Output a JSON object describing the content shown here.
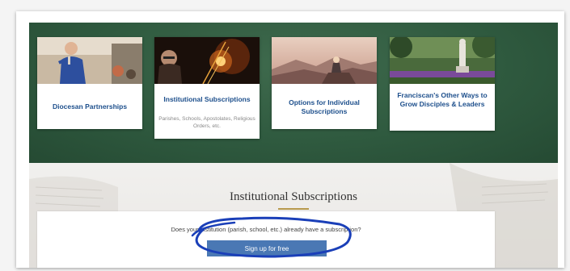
{
  "cards": [
    {
      "title": "Diocesan Partnerships",
      "subtitle": ""
    },
    {
      "title": "Institutional Subscriptions",
      "subtitle": "Parishes, Schools, Apostolates, Religious Orders, etc."
    },
    {
      "title": "Options for Individual Subscriptions",
      "subtitle": ""
    },
    {
      "title": "Franciscan's Other Ways to Grow Disciples & Leaders",
      "subtitle": ""
    }
  ],
  "section": {
    "title": "Institutional Subscriptions",
    "prompt": "Does your institution (parish, school, etc.) already have a subscription?",
    "signup_label": "Sign up for free"
  },
  "colors": {
    "hero_green": "#2f5a3f",
    "card_title_blue": "#1d4f8c",
    "button_blue": "#4a78b4",
    "accent_gold": "#b89a4e",
    "annotation_ink": "#1a3fb8"
  },
  "annotation": {
    "shape": "hand-drawn-ellipse",
    "encircles": "signup-button"
  }
}
